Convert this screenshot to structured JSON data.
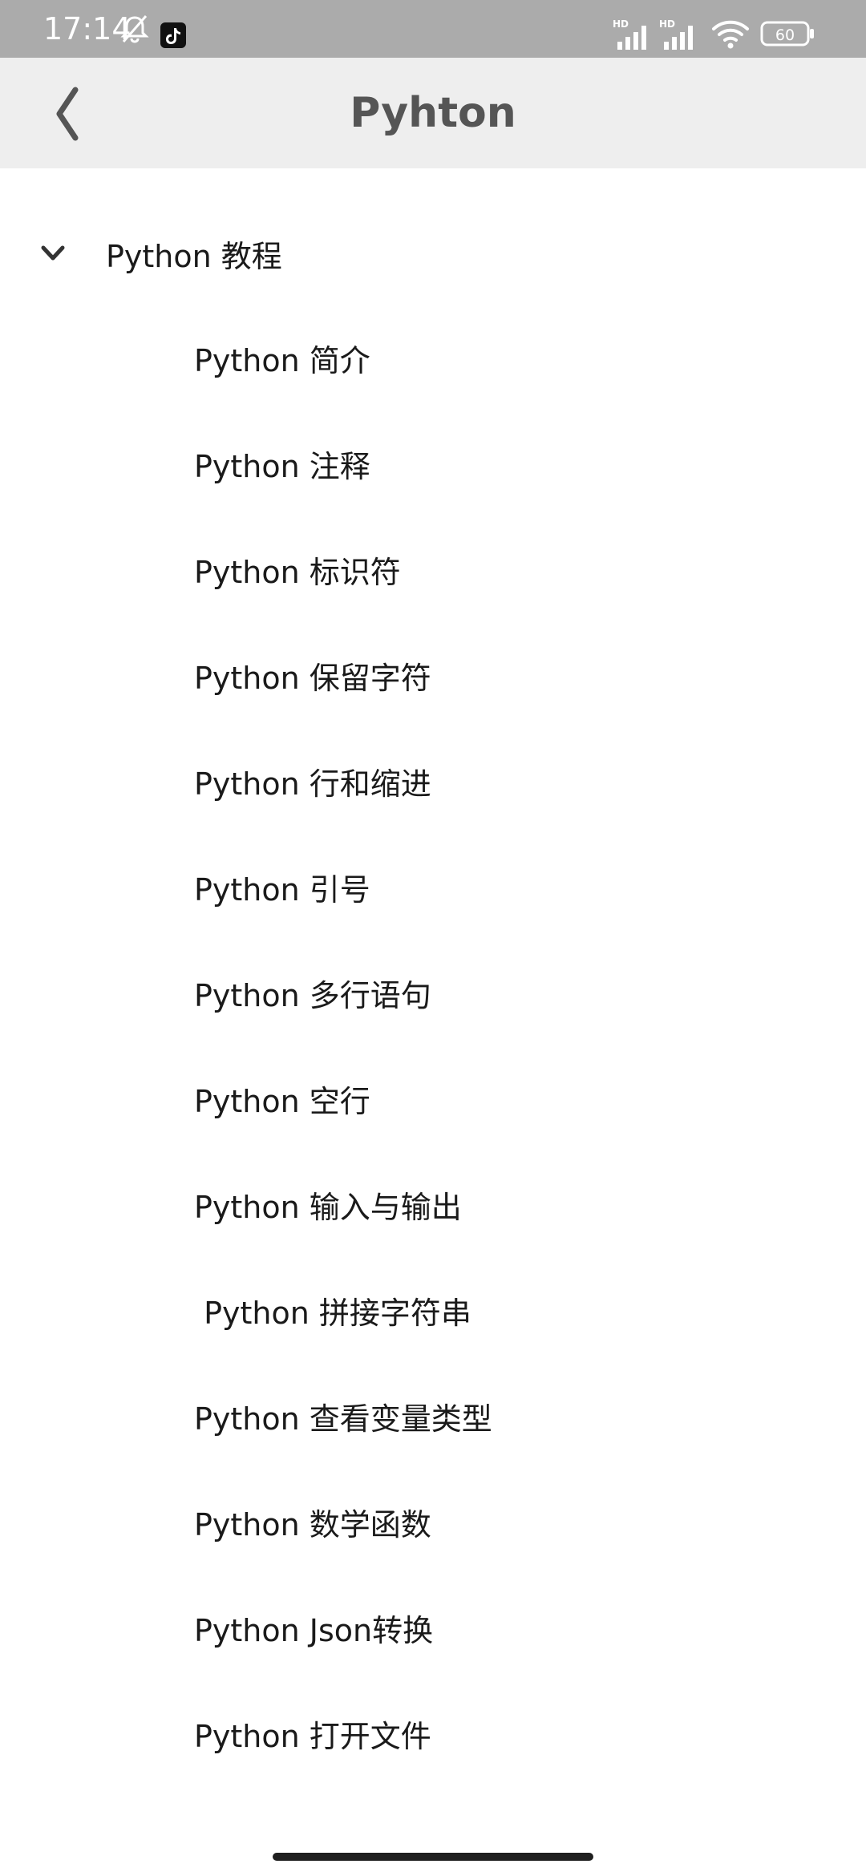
{
  "status_bar": {
    "time": "17:14",
    "left_icons": [
      "mute-bell-icon",
      "tiktok-icon"
    ],
    "signal_1_label": "HD",
    "signal_2_label": "HD",
    "battery_level": "60"
  },
  "app_bar": {
    "title": "Pyhton",
    "back_icon": "chevron-left-icon"
  },
  "tree": {
    "group": {
      "label": "Python 教程",
      "expanded": true
    },
    "items": [
      "Python 简介",
      "Python 注释",
      "Python 标识符",
      "Python 保留字符",
      "Python 行和缩进",
      "Python 引号",
      "Python 多行语句",
      "Python 空行",
      "Python 输入与输出",
      " Python 拼接字符串",
      "Python 查看变量类型",
      "Python 数学函数",
      "Python Json转换",
      "Python 打开文件"
    ]
  },
  "colors": {
    "status_bar_bg": "#ababab",
    "app_bar_bg": "#eeeeee",
    "title_color": "#555555",
    "text_color": "#1a1a1a"
  }
}
